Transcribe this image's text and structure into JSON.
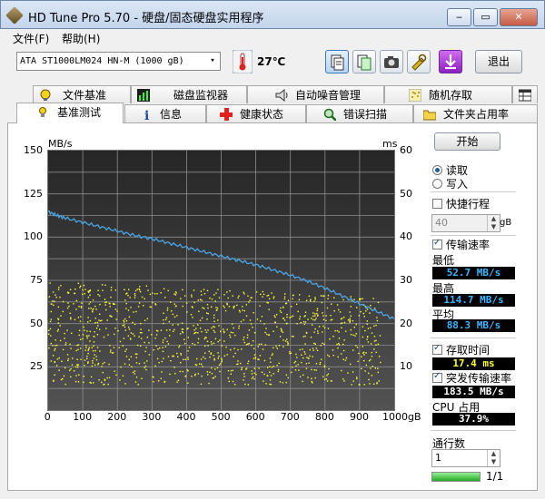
{
  "window": {
    "title": "HD Tune Pro 5.70 - 硬盘/固态硬盘实用程序",
    "minimize": "‒",
    "maximize": "▭",
    "close": "✕"
  },
  "menu": {
    "file": "文件(F)",
    "help": "帮助(H)"
  },
  "toolbar": {
    "drive": "ATA     ST1000LM024 HN-M (1000 gB)",
    "drive_arrow": "▾",
    "temperature": "27℃",
    "exit": "退出"
  },
  "tabs_top": [
    "文件基准",
    "磁盘监视器",
    "自动噪音管理",
    "随机存取",
    ""
  ],
  "tabs_bottom": [
    "基准测试",
    "信息",
    "健康状态",
    "错误扫描",
    "文件夹占用率"
  ],
  "chart_data": {
    "type": "scatter",
    "left_axis": {
      "label": "MB/s",
      "min": 0,
      "max": 150,
      "ticks": [
        25,
        50,
        75,
        100,
        125,
        150
      ]
    },
    "right_axis": {
      "label": "ms",
      "min": 0,
      "max": 60,
      "ticks": [
        10,
        20,
        30,
        40,
        50,
        60
      ]
    },
    "x_axis": {
      "unit": "gB",
      "min": 0,
      "max": 1000,
      "ticks": [
        0,
        100,
        200,
        300,
        400,
        500,
        600,
        700,
        800,
        900,
        "1000gB"
      ]
    },
    "grid": true,
    "transfer_rate": {
      "color": "#4aa6e8",
      "x": [
        0,
        25,
        50,
        100,
        150,
        200,
        250,
        300,
        350,
        400,
        450,
        500,
        550,
        600,
        650,
        700,
        750,
        800,
        850,
        900,
        950,
        1000
      ],
      "y": [
        114.7,
        112.5,
        111,
        108.5,
        106,
        103.5,
        101,
        99,
        96.5,
        94,
        91.5,
        89,
        86.5,
        84,
        81,
        78,
        74.5,
        70.5,
        66,
        61.5,
        57,
        52.7
      ]
    },
    "access_time": {
      "color": "#ffff33",
      "typical_ms_min": 6,
      "typical_ms_max": 30,
      "average_ms": 17.4
    }
  },
  "side": {
    "start": "开始",
    "read": "读取",
    "write": "写入",
    "quick_stroke": "快捷行程",
    "quick_stroke_value": "40",
    "quick_stroke_unit": "gB",
    "transfer_rate": "传输速率",
    "min_label": "最低",
    "min_value": "52.7 MB/s",
    "max_label": "最高",
    "max_value": "114.7 MB/s",
    "avg_label": "平均",
    "avg_value": "88.3 MB/s",
    "access_time_label": "存取时间",
    "access_time_value": "17.4 ms",
    "burst_label": "突发传输速率",
    "burst_value": "183.5 MB/s",
    "cpu_label": "CPU 占用",
    "cpu_value": "37.9%",
    "passes_label": "通行数",
    "passes_value": "1",
    "progress_text": "1/1",
    "progress": 1.0
  }
}
